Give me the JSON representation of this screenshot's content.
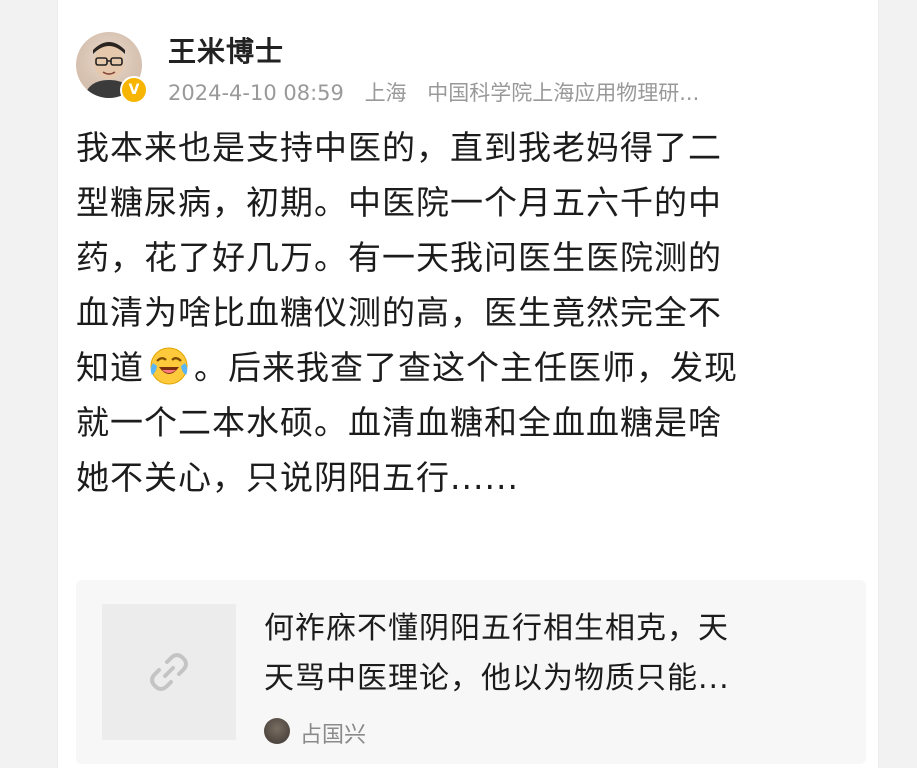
{
  "post": {
    "author": {
      "name": "王米博士",
      "verified_badge": "V",
      "badge_color": "#f7b500"
    },
    "meta": {
      "datetime": "2024-4-10 08:59",
      "location": "上海",
      "affiliation": "中国科学院上海应用物理研..."
    },
    "body_lines": [
      "我本来也是支持中医的，直到我老妈得了二",
      "型糖尿病，初期。中医院一个月五六千的中",
      "药，花了好几万。有一天我问医生医院测的",
      "血清为啥比血糖仪测的高，医生竟然完全不"
    ],
    "body_line5_before": "知道",
    "body_line5_after": "。后来我查了查这个主任医师，发现",
    "body_lines_rest": [
      "就一个二本水硕。血清血糖和全血血糖是啥",
      "她不关心，只说阴阳五行......"
    ],
    "emoji": "laughing-crying-emoji"
  },
  "link_card": {
    "title_lines": [
      "何祚庥不懂阴阳五行相生相克，天",
      "天骂中医理论，他以为物质只能..."
    ],
    "author": "占国兴",
    "thumb_icon": "link-icon"
  }
}
